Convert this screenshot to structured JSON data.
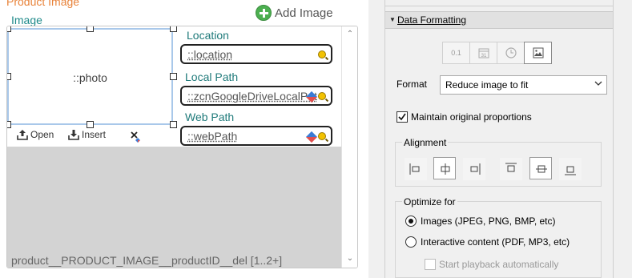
{
  "canvas": {
    "title": "Product Image",
    "subtitle": "Image",
    "add_image_label": "Add Image",
    "photo_placeholder": "::photo",
    "toolbar": {
      "open_label": "Open",
      "insert_label": "Insert"
    },
    "fields": [
      {
        "label": "Location",
        "value": "::location"
      },
      {
        "label": "Local Path",
        "value": "::zcnGoogleDriveLocalPath"
      },
      {
        "label": "Web Path",
        "value": "::webPath"
      }
    ],
    "portal_label": "product__PRODUCT_IMAGE__productID__del [1..2+]"
  },
  "inspector": {
    "section_title": "Data Formatting",
    "format_type_buttons": [
      {
        "name": "number",
        "text": "0.1",
        "icon": "number-format-icon"
      },
      {
        "name": "date",
        "text": "31",
        "icon": "calendar-icon"
      },
      {
        "name": "time",
        "icon": "clock-icon"
      },
      {
        "name": "container",
        "icon": "image-icon",
        "active": true
      }
    ],
    "format_label": "Format",
    "format_value": "Reduce image to fit",
    "maintain_proportions_label": "Maintain original proportions",
    "maintain_proportions_checked": true,
    "alignment_title": "Alignment",
    "horizontal_alignment": [
      "left",
      "center",
      "right"
    ],
    "horizontal_selected": "center",
    "vertical_alignment": [
      "top",
      "middle",
      "bottom"
    ],
    "vertical_selected": "middle",
    "optimize_title": "Optimize for",
    "optimize_options": [
      {
        "label": "Images (JPEG, PNG, BMP, etc)",
        "selected": true
      },
      {
        "label": "Interactive content (PDF, MP3, etc)",
        "selected": false
      }
    ],
    "start_playback_label": "Start playback automatically",
    "start_playback_checked": false
  },
  "colors": {
    "title_orange": "#e8833a",
    "label_teal": "#1f7a7a",
    "selection_blue": "#a9c8ea",
    "portal_gray": "#d3d3d3",
    "panel_bg": "#f0f0f0"
  }
}
